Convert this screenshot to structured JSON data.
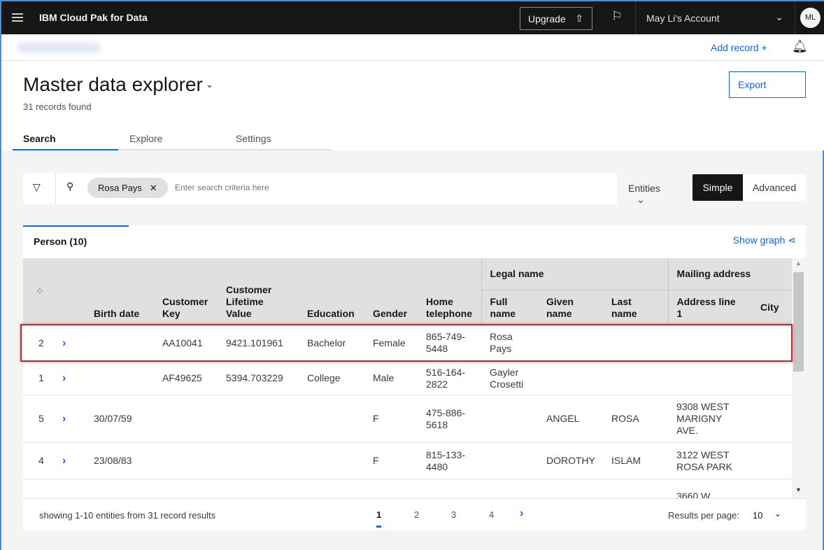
{
  "topbar": {
    "brand": "IBM Cloud Pak for Data",
    "upgrade": "Upgrade",
    "upgrade_icon": "⇧",
    "account": "May Li's Account",
    "avatar": "ML"
  },
  "subbar": {
    "add_record": "Add record  +"
  },
  "header": {
    "title": "Master data explorer",
    "count": "31 records found",
    "export": "Export",
    "tabs": [
      "Search",
      "Explore",
      "Settings"
    ]
  },
  "search": {
    "chip": "Rosa Pays",
    "placeholder": "Enter search criteria here",
    "entities": "Entities",
    "simple": "Simple",
    "advanced": "Advanced"
  },
  "results": {
    "tab": "Person (10)",
    "show_graph": "Show graph",
    "groups": {
      "legal": "Legal name",
      "mailing": "Mailing address"
    },
    "columns": [
      "",
      "",
      "Birth date",
      "Customer Key",
      "Customer Lifetime Value",
      "Education",
      "Gender",
      "Home telephone",
      "Full name",
      "Given name",
      "Last name",
      "Address line 1",
      "City"
    ],
    "rows": [
      [
        "2",
        "",
        "AA10041",
        "9421.101961",
        "Bachelor",
        "Female",
        "865-749-5448",
        "Rosa Pays",
        "",
        "",
        "",
        ""
      ],
      [
        "1",
        "",
        "AF49625",
        "5394.703229",
        "College",
        "Male",
        "516-164-2822",
        "Gayler Crosetti",
        "",
        "",
        "",
        ""
      ],
      [
        "5",
        "30/07/59",
        "",
        "",
        "",
        "F",
        "475-886-5618",
        "",
        "ANGEL",
        "ROSA",
        "9308 WEST MARIGNY AVE.",
        ""
      ],
      [
        "4",
        "23/08/83",
        "",
        "",
        "",
        "F",
        "815-133-4480",
        "",
        "DOROTHY",
        "ISLAM",
        "3122 WEST ROSA PARK",
        ""
      ],
      [
        "",
        "",
        "",
        "",
        "",
        "",
        "",
        "",
        "",
        "",
        "3660 W",
        ""
      ]
    ],
    "highlight_color": "#da1e28"
  },
  "footer": {
    "showing": "showing 1-10 entities from 31 record results",
    "pages": [
      "1",
      "2",
      "3",
      "4"
    ],
    "current_page": "1",
    "rpp_label": "Results per page:",
    "rpp_value": "10"
  }
}
